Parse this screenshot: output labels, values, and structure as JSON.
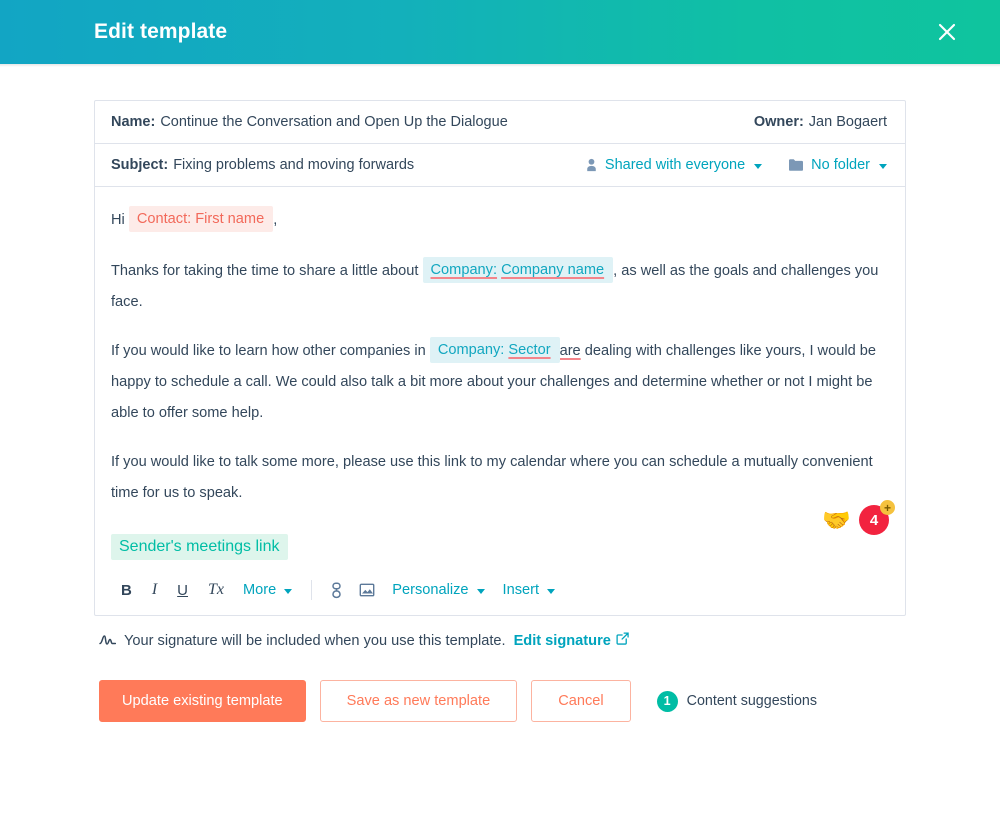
{
  "header": {
    "title": "Edit template",
    "close_icon": "close-icon",
    "gradient_start": "#12a5c4",
    "gradient_end": "#0fc49e"
  },
  "template_meta": {
    "name_label": "Name:",
    "name_value": "Continue the Conversation and Open Up the Dialogue",
    "owner_label": "Owner:",
    "owner_value": "Jan Bogaert",
    "subject_label": "Subject:",
    "subject_value": "Fixing problems and moving forwards",
    "sharing": {
      "icon": "person-icon",
      "label": "Shared with everyone",
      "caret": "chevron-down-icon"
    },
    "folder": {
      "icon": "folder-icon",
      "label": "No folder",
      "caret": "chevron-down-icon"
    }
  },
  "email_body": {
    "greeting_prefix": "Hi",
    "greeting_token": "Contact: First name",
    "greeting_suffix": ",",
    "p2_before": "Thanks for taking the time to share a little about",
    "p2_token_prefix": "Company:",
    "p2_token_value": "Company name",
    "p2_after": ", as well as the goals and challenges you face.",
    "p3_before": "If you would like to learn how other companies in",
    "p3_token_prefix": "Company:",
    "p3_token_value": "Sector",
    "p3_after_spell": "are",
    "p3_after": "dealing with challenges like yours, I would be happy to schedule a call. We could also talk a bit more about your challenges and determine whether or not I might be able to offer some help.",
    "p4": "If you would like to talk some more, please use this link to my calendar where you can schedule a mutually convenient time for us to speak.",
    "meetings_token": "Sender's meetings link",
    "reaction_emoji": "🤝",
    "reaction_count": "4",
    "reaction_add": "+"
  },
  "toolbar": {
    "bold": "B",
    "italic": "I",
    "underline": "U",
    "clear_format": "Tx",
    "more_label": "More",
    "link_icon": "link-icon",
    "image_icon": "image-icon",
    "personalize_label": "Personalize",
    "insert_label": "Insert"
  },
  "signature": {
    "icon": "signature-icon",
    "text": "Your signature will be included when you use this template.",
    "link_label": "Edit signature",
    "external_icon": "external-link-icon"
  },
  "footer": {
    "primary_label": "Update existing template",
    "save_new_label": "Save as new template",
    "cancel_label": "Cancel",
    "suggestions_count": "1",
    "suggestions_label": "Content suggestions",
    "primary_color": "#ff7a59",
    "badge_color": "#00bda5"
  }
}
